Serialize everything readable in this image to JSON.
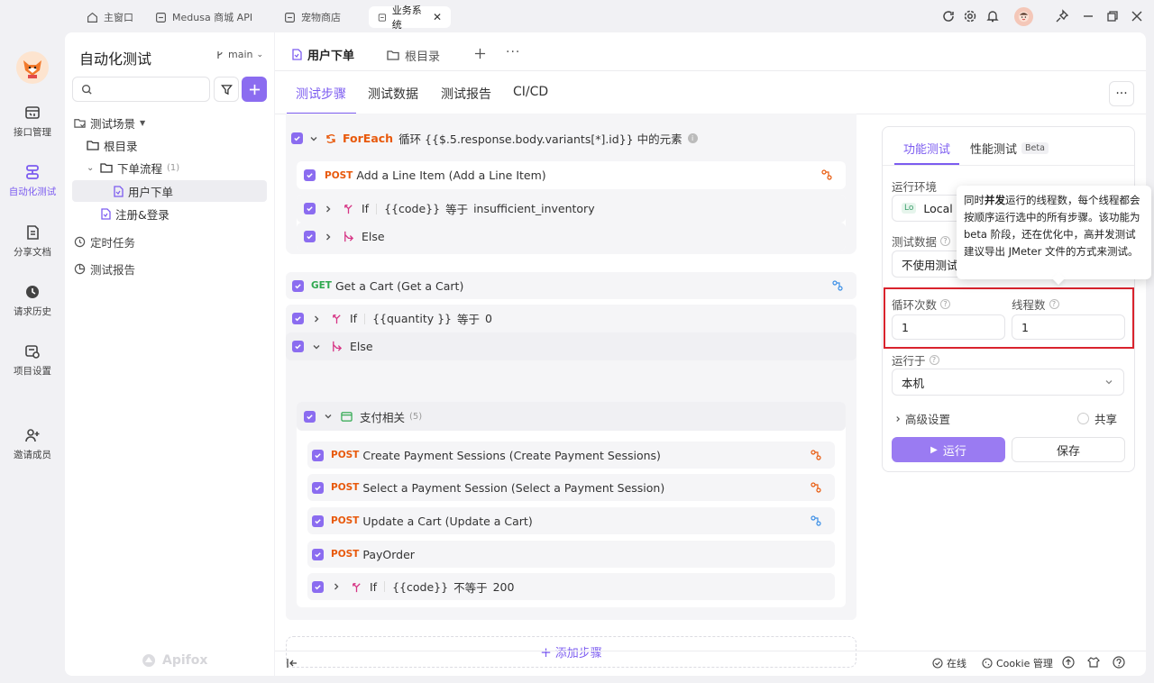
{
  "titlebar": {
    "tabs": [
      {
        "label": "主窗口"
      },
      {
        "label": "Medusa 商城 API"
      },
      {
        "label": "宠物商店"
      },
      {
        "label": "业务系统"
      }
    ]
  },
  "rail": {
    "items": [
      {
        "label": "接口管理"
      },
      {
        "label": "自动化测试"
      },
      {
        "label": "分享文档"
      },
      {
        "label": "请求历史"
      },
      {
        "label": "项目设置"
      },
      {
        "label": "邀请成员"
      }
    ]
  },
  "sidebar": {
    "title": "自动化测试",
    "branch": "main",
    "tree": {
      "scenarios_label": "测试场景",
      "root": "根目录",
      "folder": "下单流程",
      "folder_count": "(1)",
      "case": "用户下单",
      "case2": "注册&登录",
      "scheduled": "定时任务",
      "reports": "测试报告"
    },
    "brand": "Apifox"
  },
  "main": {
    "doc_tabs": [
      {
        "label": "用户下单"
      },
      {
        "label": "根目录"
      }
    ],
    "subtabs": [
      "测试步骤",
      "测试数据",
      "测试报告",
      "CI/CD"
    ],
    "steps": {
      "foreach": {
        "keyword": "ForEach",
        "text": "循环 {{$.5.response.body.variants[*].id}} 中的元素"
      },
      "add_line": {
        "method": "POST",
        "text": "Add a Line Item (Add a Line Item)"
      },
      "if1": {
        "keyword": "If",
        "left": "{{code}}",
        "op": "等于",
        "right": "insufficient_inventory"
      },
      "else1": {
        "keyword": "Else"
      },
      "get_cart": {
        "method": "GET",
        "text": "Get a Cart (Get a Cart)"
      },
      "if2": {
        "keyword": "If",
        "left": "{{quantity }}",
        "op": "等于",
        "right": "0"
      },
      "else2": {
        "keyword": "Else"
      },
      "group": {
        "label": "支付相关",
        "count": "(5)"
      },
      "create_sess": {
        "method": "POST",
        "text": "Create Payment Sessions (Create Payment Sessions)"
      },
      "select_sess": {
        "method": "POST",
        "text": "Select a Payment Session (Select a Payment Session)"
      },
      "update_cart": {
        "method": "POST",
        "text": "Update a Cart (Update a Cart)"
      },
      "payorder": {
        "method": "POST",
        "text": "PayOrder"
      },
      "if3": {
        "keyword": "If",
        "left": "{{code}}",
        "op": "不等于",
        "right": "200"
      }
    },
    "add_step": "添加步骤"
  },
  "runpanel": {
    "tabs": [
      "功能测试",
      "性能测试"
    ],
    "beta": "Beta",
    "env_label": "运行环境",
    "env_value": "Local M",
    "env_badge": "Lo",
    "data_label": "测试数据",
    "data_value": "不使用测试",
    "loops_label": "循环次数",
    "loops_value": "1",
    "threads_label": "线程数",
    "threads_value": "1",
    "runon_label": "运行于",
    "runon_value": "本机",
    "advanced": "高级设置",
    "share": "共享",
    "run": "运行",
    "save": "保存",
    "tooltip_pre": "同时",
    "tooltip_bold": "并发",
    "tooltip_post": "运行的线程数，每个线程都会按顺序运行选中的所有步骤。该功能为 beta 阶段，还在优化中，高并发测试建议导出 JMeter 文件的方式来测试。"
  },
  "statusbar": {
    "online": "在线",
    "cookie": "Cookie 管理"
  },
  "colors": {
    "accent": "#8b6cf0",
    "post": "#e8590c",
    "get": "#2fa84f",
    "highlight": "#d9232d"
  }
}
